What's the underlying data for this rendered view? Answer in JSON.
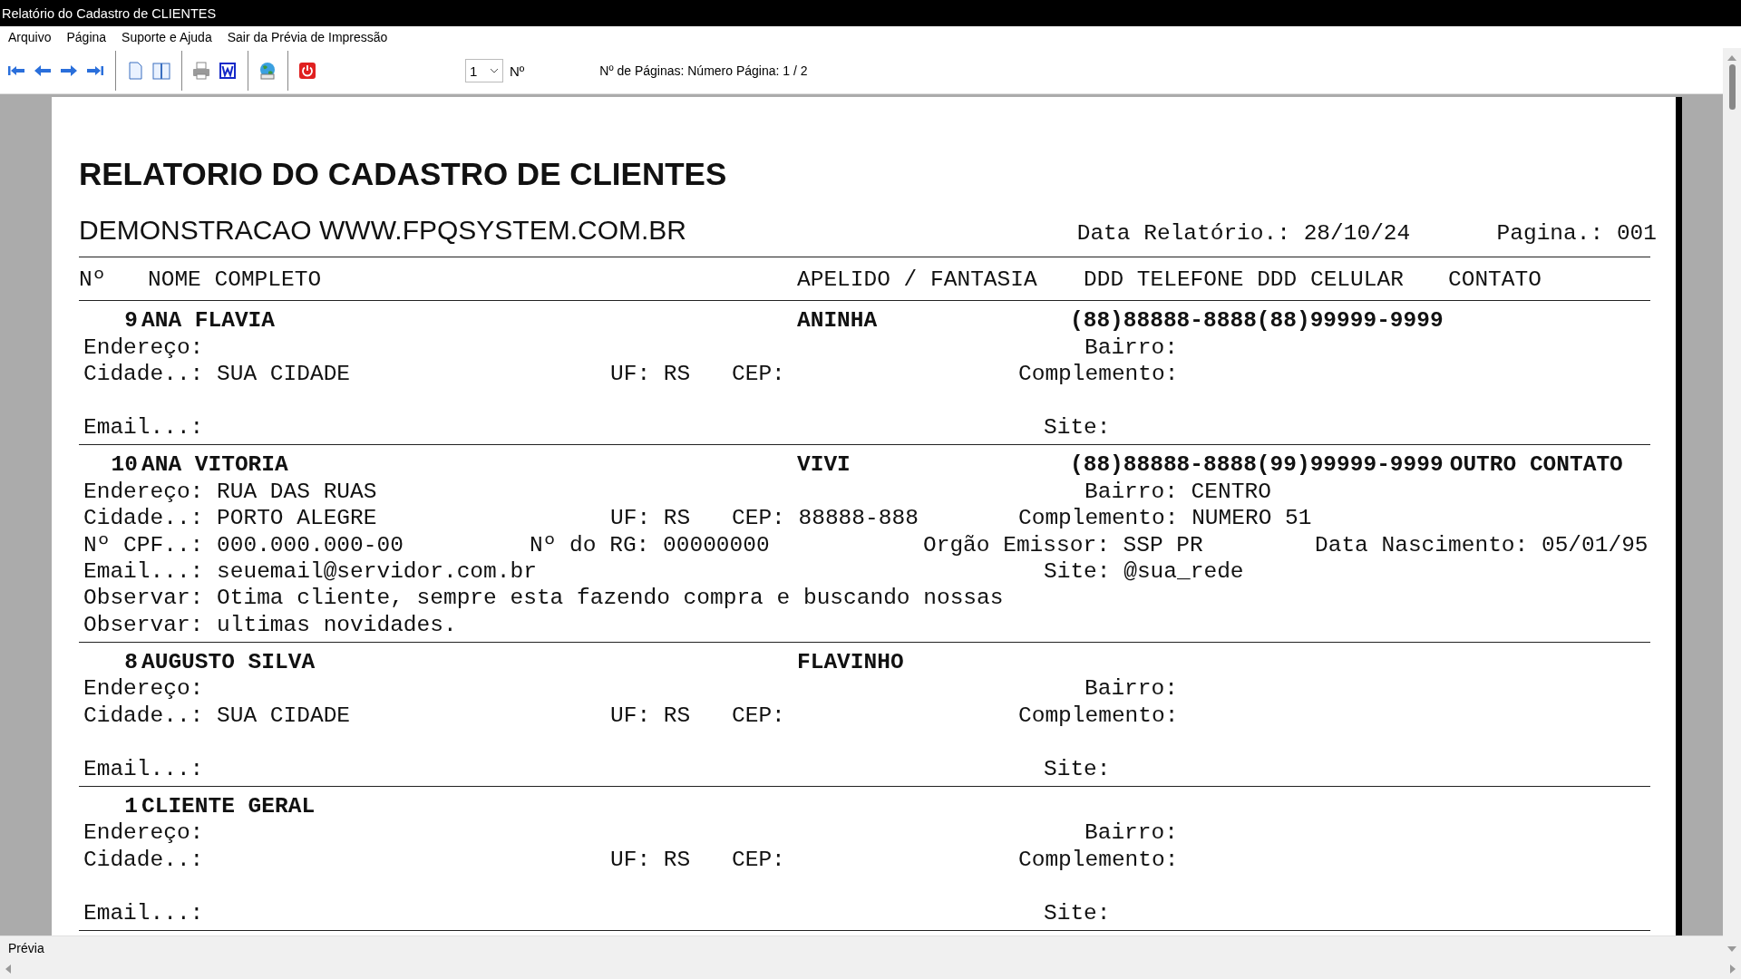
{
  "window": {
    "title": "Relatório do Cadastro de CLIENTES"
  },
  "menu": [
    "Arquivo",
    "Página",
    "Suporte e Ajuda",
    "Sair da Prévia de Impressão"
  ],
  "toolbar": {
    "page_select": "1",
    "page_select_label": "Nº",
    "page_info": "Nº de Páginas: Número Página: 1 / 2"
  },
  "report": {
    "title": "RELATORIO DO CADASTRO DE CLIENTES",
    "subtitle": "DEMONSTRACAO WWW.FPQSYSTEM.COM.BR",
    "date": "Data Relatório.: 28/10/24",
    "page": "Pagina.: 001",
    "columns": [
      "Nº",
      "NOME COMPLETO",
      "APELIDO / FANTASIA",
      "DDD TELEFONE DDD CELULAR",
      "CONTATO"
    ],
    "records": [
      {
        "number": "9",
        "name": "ANA FLAVIA",
        "nickname": "ANINHA",
        "phone": "(88)88888-8888",
        "mobile": "(88)99999-9999",
        "address": {
          "label": "Endereço:"
        },
        "district": {
          "label": "Bairro:"
        },
        "city": {
          "label": "Cidade..:",
          "value": "SUA CIDADE"
        },
        "state": {
          "label": "UF:",
          "value": "RS"
        },
        "zip": {
          "label": "CEP:"
        },
        "complement": {
          "label": "Complemento:"
        },
        "email": {
          "label": "Email...:"
        },
        "site": {
          "label": "Site:"
        }
      },
      {
        "number": "10",
        "name": "ANA VITORIA",
        "nickname": "VIVI",
        "phone": "(88)88888-8888",
        "mobile": "(99)99999-9999",
        "contact": "OUTRO CONTATO",
        "address": {
          "label": "Endereço:",
          "value": "RUA DAS RUAS"
        },
        "district": {
          "label": "Bairro:",
          "value": "CENTRO"
        },
        "city": {
          "label": "Cidade..:",
          "value": "PORTO ALEGRE"
        },
        "state": {
          "label": "UF:",
          "value": "RS"
        },
        "zip": {
          "label": "CEP:",
          "value": "88888-888"
        },
        "complement": {
          "label": "Complemento:",
          "value": "NUMERO 51"
        },
        "cpf": {
          "label": "Nº CPF..:",
          "value": "000.000.000-00"
        },
        "rg": {
          "label": "Nº do RG:",
          "value": "00000000"
        },
        "issuer": {
          "label": "Orgão Emissor:",
          "value": "SSP PR"
        },
        "birth_date": {
          "label": "Data Nascimento:",
          "value": "05/01/95"
        },
        "email": {
          "label": "Email...:",
          "value": "seuemail@servidor.com.br"
        },
        "site": {
          "label": "Site:",
          "value": "@sua_rede"
        },
        "notes": [
          {
            "label": "Observar:",
            "value": "Otima cliente, sempre esta fazendo compra e buscando nossas"
          },
          {
            "label": "Observar:",
            "value": "ultimas novidades."
          }
        ]
      },
      {
        "number": "8",
        "name": "AUGUSTO SILVA",
        "nickname": "FLAVINHO",
        "address": {
          "label": "Endereço:"
        },
        "district": {
          "label": "Bairro:"
        },
        "city": {
          "label": "Cidade..:",
          "value": "SUA CIDADE"
        },
        "state": {
          "label": "UF:",
          "value": "RS"
        },
        "zip": {
          "label": "CEP:"
        },
        "complement": {
          "label": "Complemento:"
        },
        "email": {
          "label": "Email...:"
        },
        "site": {
          "label": "Site:"
        }
      },
      {
        "number": "1",
        "name": "CLIENTE GERAL",
        "address": {
          "label": "Endereço:"
        },
        "district": {
          "label": "Bairro:"
        },
        "city": {
          "label": "Cidade..:"
        },
        "state": {
          "label": "UF:",
          "value": "RS"
        },
        "zip": {
          "label": "CEP:"
        },
        "complement": {
          "label": "Complemento:"
        },
        "email": {
          "label": "Email...:"
        },
        "site": {
          "label": "Site:"
        }
      }
    ]
  },
  "status_bar": "Prévia"
}
